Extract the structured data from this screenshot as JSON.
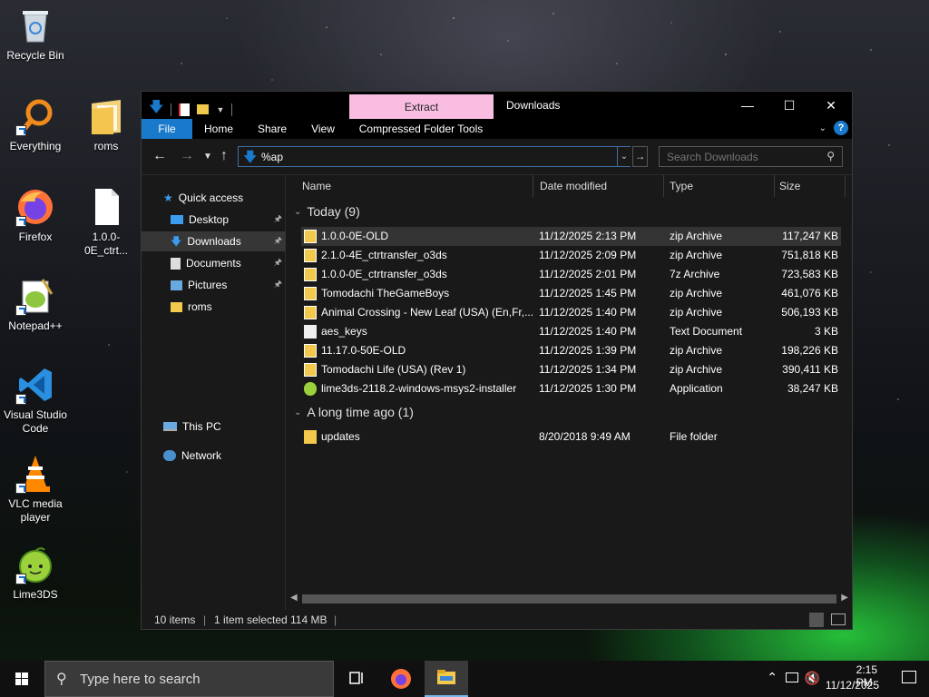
{
  "desktop": {
    "icons": [
      {
        "label": "Recycle Bin"
      },
      {
        "label": "Everything"
      },
      {
        "label": "roms"
      },
      {
        "label": "Firefox"
      },
      {
        "label": "1.0.0-0E_ctrt..."
      },
      {
        "label": "Notepad++"
      },
      {
        "label": "Visual Studio Code"
      },
      {
        "label": "VLC media player"
      },
      {
        "label": "Lime3DS"
      }
    ]
  },
  "window": {
    "context_tab": "Extract",
    "title": "Downloads",
    "ribbon_tabs": [
      "File",
      "Home",
      "Share",
      "View",
      "Compressed Folder Tools"
    ],
    "address_value": "%ap",
    "search_placeholder": "Search Downloads",
    "nav": [
      {
        "label": "Quick access",
        "icon": "star-icon"
      },
      {
        "label": "Desktop",
        "icon": "desktop-icon",
        "pinned": true
      },
      {
        "label": "Downloads",
        "icon": "download-icon",
        "pinned": true,
        "selected": true
      },
      {
        "label": "Documents",
        "icon": "document-icon",
        "pinned": true
      },
      {
        "label": "Pictures",
        "icon": "pictures-icon",
        "pinned": true
      },
      {
        "label": "roms",
        "icon": "folder-icon"
      },
      {
        "label": "This PC",
        "icon": "computer-icon"
      },
      {
        "label": "Network",
        "icon": "network-icon"
      }
    ],
    "columns": [
      "Name",
      "Date modified",
      "Type",
      "Size"
    ],
    "groups": [
      {
        "label": "Today (9)",
        "rows": [
          {
            "name": "1.0.0-0E-OLD",
            "date": "11/12/2025 2:13 PM",
            "type": "zip Archive",
            "size": "117,247 KB",
            "icon": "zip-icon",
            "selected": true
          },
          {
            "name": "2.1.0-4E_ctrtransfer_o3ds",
            "date": "11/12/2025 2:09 PM",
            "type": "zip Archive",
            "size": "751,818 KB",
            "icon": "zip-icon"
          },
          {
            "name": "1.0.0-0E_ctrtransfer_o3ds",
            "date": "11/12/2025 2:01 PM",
            "type": "7z Archive",
            "size": "723,583 KB",
            "icon": "7z-icon"
          },
          {
            "name": "Tomodachi TheGameBoys",
            "date": "11/12/2025 1:45 PM",
            "type": "zip Archive",
            "size": "461,076 KB",
            "icon": "zip-icon"
          },
          {
            "name": "Animal Crossing - New Leaf (USA) (En,Fr,...",
            "date": "11/12/2025 1:40 PM",
            "type": "zip Archive",
            "size": "506,193 KB",
            "icon": "zip-icon"
          },
          {
            "name": "aes_keys",
            "date": "11/12/2025 1:40 PM",
            "type": "Text Document",
            "size": "3 KB",
            "icon": "text-file-icon"
          },
          {
            "name": "11.17.0-50E-OLD",
            "date": "11/12/2025 1:39 PM",
            "type": "zip Archive",
            "size": "198,226 KB",
            "icon": "zip-icon"
          },
          {
            "name": "Tomodachi Life (USA) (Rev 1)",
            "date": "11/12/2025 1:34 PM",
            "type": "zip Archive",
            "size": "390,411 KB",
            "icon": "zip-icon"
          },
          {
            "name": "lime3ds-2118.2-windows-msys2-installer",
            "date": "11/12/2025 1:30 PM",
            "type": "Application",
            "size": "38,247 KB",
            "icon": "lime-app-icon"
          }
        ]
      },
      {
        "label": "A long time ago (1)",
        "rows": [
          {
            "name": "updates",
            "date": "8/20/2018 9:49 AM",
            "type": "File folder",
            "size": "",
            "icon": "folder-icon"
          }
        ]
      }
    ],
    "status": {
      "count": "10 items",
      "selected": "1 item selected",
      "size": "114 MB"
    }
  },
  "taskbar": {
    "search_placeholder": "Type here to search",
    "time": "2:15 PM",
    "date": "11/12/2025"
  },
  "colors": {
    "accent": "#1979ca",
    "context_tab": "#f9bde2",
    "folder": "#f2c94c"
  }
}
